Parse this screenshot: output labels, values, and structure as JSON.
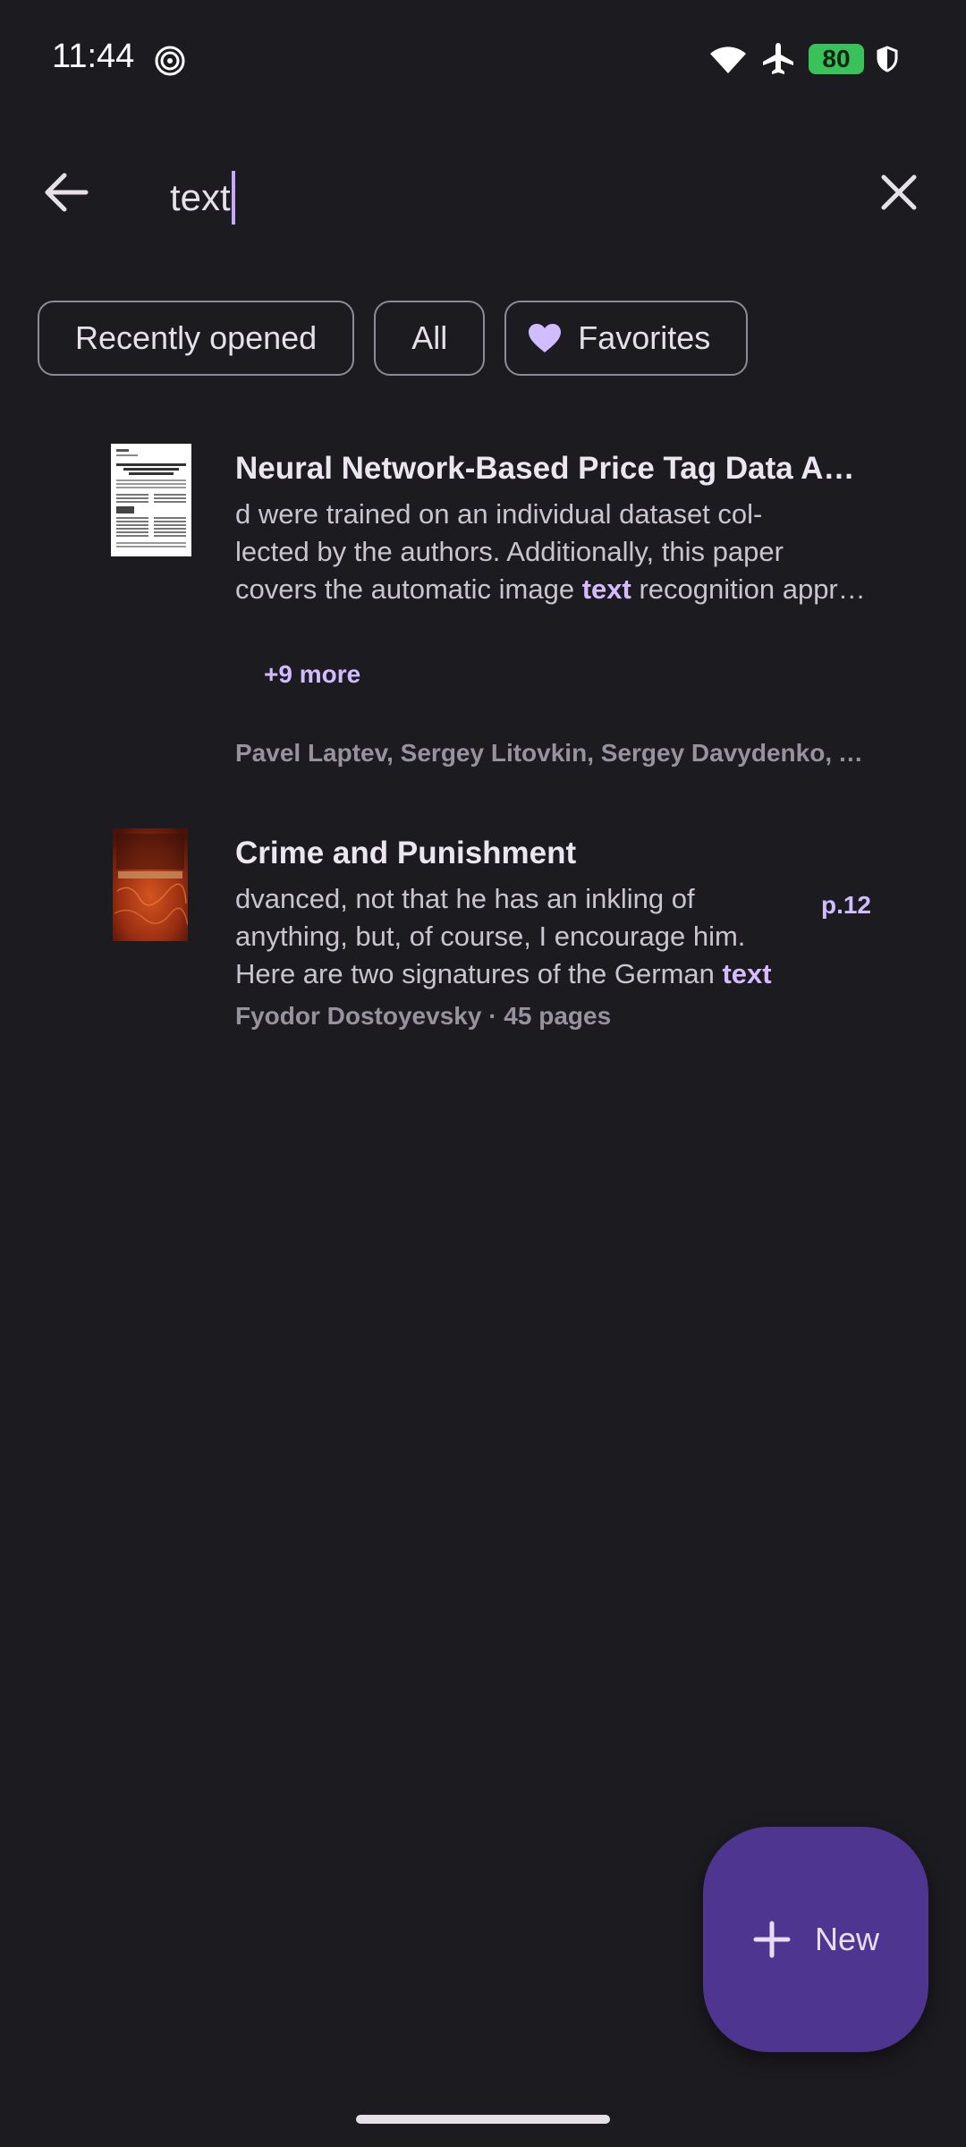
{
  "status_bar": {
    "time": "11:44",
    "battery": "80",
    "icons": [
      "spiral-icon",
      "wifi-icon",
      "airplane-icon",
      "battery-icon",
      "shield-icon"
    ]
  },
  "search": {
    "query": "text",
    "back_icon": "arrow-back-icon",
    "clear_icon": "close-icon"
  },
  "chips": [
    {
      "label": "Recently opened"
    },
    {
      "label": "All"
    },
    {
      "label": "Favorites",
      "icon": "heart-icon"
    }
  ],
  "results": [
    {
      "title": "Neural Network-Based Price Tag Data Analysis",
      "snippet_line1": "d were trained on an individual dataset col-",
      "snippet_line2": "lected by the authors. Additionally, this paper",
      "snippet_line3_before": "covers the automatic image ",
      "snippet_highlight": "text",
      "snippet_line3_after": " recognition approach",
      "more": "+9 more",
      "authors": "Pavel Laptev, Sergey Litovkin, Sergey Davydenko, Anton Konev"
    },
    {
      "title": "Crime and Punishment",
      "snippet_line1": "dvanced, not that he has an inkling of",
      "snippet_line2": "anything, but, of course, I encourage him.",
      "snippet_line3_before": "Here are two signatures of the German ",
      "snippet_highlight": "text",
      "page": "p.12",
      "meta": "Fyodor Dostoyevsky · 45 pages",
      "cover_title": "Crime and Punishment"
    }
  ],
  "fab": {
    "label": "New",
    "icon": "plus-icon"
  },
  "colors": {
    "background": "#1c1b20",
    "accent": "#d0bcff",
    "fab": "#4d3590",
    "battery": "#3ac25a"
  }
}
